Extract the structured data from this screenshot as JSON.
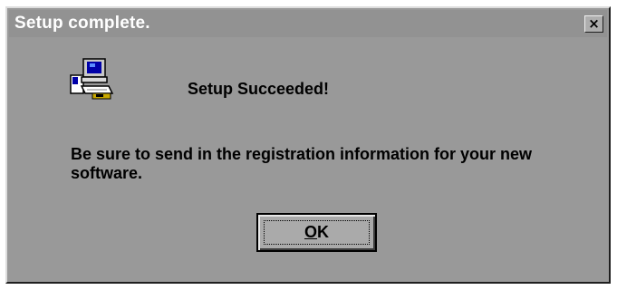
{
  "window": {
    "title": "Setup complete.",
    "close_label": "×"
  },
  "content": {
    "icon": "setup-computer-icon",
    "headline": "Setup Succeeded!",
    "message": "Be sure to send in the registration information for your new software."
  },
  "ok_button": {
    "label_mnemonic": "O",
    "label_rest": "K"
  },
  "colors": {
    "dialog_face": "#999999",
    "titlebar": "#929292",
    "title_text": "#ffffff"
  }
}
